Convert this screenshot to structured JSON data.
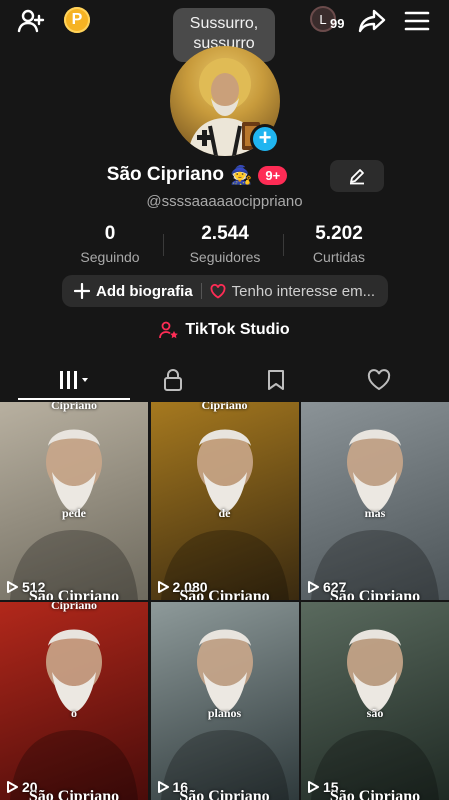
{
  "header": {
    "tooltip": "Sussurro, sussurro",
    "coin_label": "P",
    "level_letter": "L",
    "level_count": "99"
  },
  "profile": {
    "name": "São Cipriano",
    "name_emoji": "🧙",
    "notification_badge": "9+",
    "handle": "@ssssaaaaaocippriano",
    "avatar_plus": "+"
  },
  "stats": [
    {
      "value": "0",
      "label": "Seguindo"
    },
    {
      "value": "2.544",
      "label": "Seguidores"
    },
    {
      "value": "5.202",
      "label": "Curtidas"
    }
  ],
  "bio": {
    "add_label": "Add biografia",
    "interest_label": "Tenho interesse em..."
  },
  "studio": {
    "label": "TikTok Studio"
  },
  "tabs": [
    "videos-grid",
    "private",
    "saved",
    "liked"
  ],
  "videos": [
    {
      "caption_top": "Cipriano",
      "caption_mid": "pede",
      "views": "512",
      "brand": "São Cipriano",
      "bg": [
        "#6e6a5e",
        "#b8b0a0"
      ]
    },
    {
      "caption_top": "Cipriano",
      "caption_mid": "de",
      "views": "2.080",
      "brand": "São Cipriano",
      "bg": [
        "#3a2a10",
        "#a6791f"
      ]
    },
    {
      "caption_top": "",
      "caption_mid": "mas",
      "views": "627",
      "brand": "São Cipriano",
      "bg": [
        "#4c5458",
        "#8b9397"
      ]
    },
    {
      "caption_top": "Cipriano",
      "caption_mid": "o",
      "views": "20",
      "brand": "São Cipriano",
      "bg": [
        "#4a0c0a",
        "#b2281b"
      ]
    },
    {
      "caption_top": "",
      "caption_mid": "planos",
      "views": "16",
      "brand": "São Cipriano",
      "bg": [
        "#2f3a3c",
        "#8e9a9a"
      ]
    },
    {
      "caption_top": "",
      "caption_mid": "são",
      "views": "15",
      "brand": "São Cipriano",
      "bg": [
        "#1f2a24",
        "#5a6a5e"
      ]
    }
  ],
  "colors": {
    "accent_pink": "#fe2c55",
    "plus_blue": "#20b5f0",
    "coin": "#f6b323"
  }
}
